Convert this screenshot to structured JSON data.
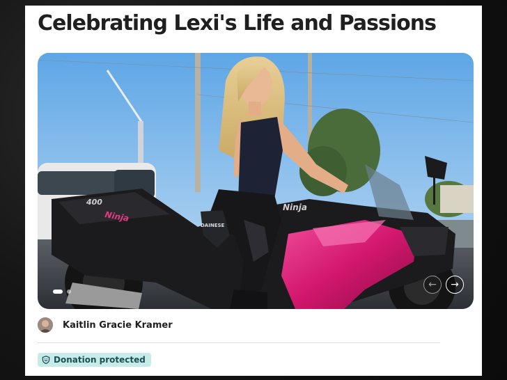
{
  "page": {
    "title": "Celebrating Lexi's Life and Passions"
  },
  "photo": {
    "bike_text_left": "400",
    "bike_brand_left": "Ninja",
    "bike_brand_right": "Ninja",
    "pants_brand": "DAINESE",
    "nav_prev_icon": "arrow-left-icon",
    "nav_next_icon": "arrow-right-icon",
    "nav_prev_glyph": "←",
    "nav_next_glyph": "→",
    "slides": {
      "count": 2,
      "active": 1
    }
  },
  "organizer": {
    "name": "Kaitlin Gracie Kramer"
  },
  "badge": {
    "label": "Donation protected",
    "icon": "shield-icon"
  },
  "colors": {
    "badge_bg": "#c5ece8",
    "badge_text": "#1d4e56",
    "bike_pink": "#d2176e"
  }
}
